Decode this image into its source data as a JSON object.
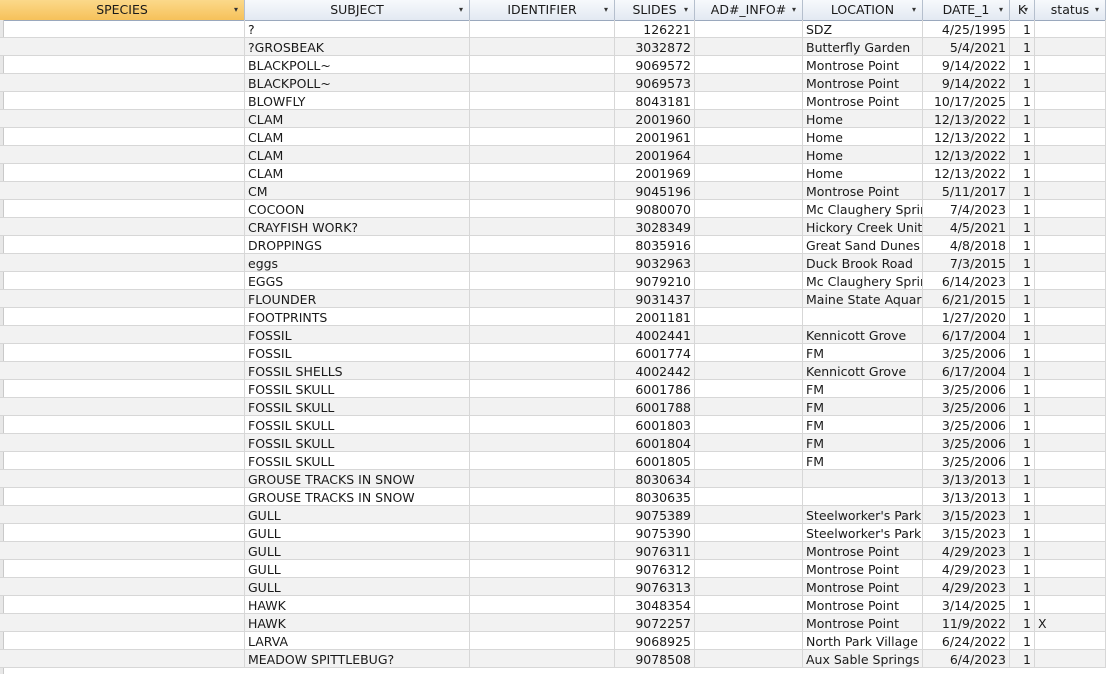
{
  "columns": [
    {
      "key": "species",
      "label": "SPECIES",
      "arrow": "sort-filter",
      "selected": true
    },
    {
      "key": "subject",
      "label": "SUBJECT",
      "arrow": "sort-filter"
    },
    {
      "key": "identifier",
      "label": "IDENTIFIER",
      "arrow": "filter"
    },
    {
      "key": "slides",
      "label": "SLIDES",
      "arrow": "sort-filter"
    },
    {
      "key": "ad_info",
      "label": "AD#_INFO#",
      "arrow": "filter"
    },
    {
      "key": "location",
      "label": "LOCATION",
      "arrow": "filter"
    },
    {
      "key": "date_1",
      "label": "DATE_1",
      "arrow": "filter"
    },
    {
      "key": "k",
      "label": "K",
      "arrow": "filter"
    },
    {
      "key": "status",
      "label": "status",
      "arrow": "filter"
    }
  ],
  "rows": [
    {
      "species": "",
      "subject": "?",
      "identifier": "",
      "slides": "126221",
      "ad_info": "",
      "location": "SDZ",
      "date_1": "4/25/1995",
      "k": "1",
      "status": ""
    },
    {
      "species": "",
      "subject": "?GROSBEAK",
      "identifier": "",
      "slides": "3032872",
      "ad_info": "",
      "location": "Butterfly Garden",
      "date_1": "5/4/2021",
      "k": "1",
      "status": ""
    },
    {
      "species": "",
      "subject": "BLACKPOLL~",
      "identifier": "",
      "slides": "9069572",
      "ad_info": "",
      "location": "Montrose Point",
      "date_1": "9/14/2022",
      "k": "1",
      "status": ""
    },
    {
      "species": "",
      "subject": "BLACKPOLL~",
      "identifier": "",
      "slides": "9069573",
      "ad_info": "",
      "location": "Montrose Point",
      "date_1": "9/14/2022",
      "k": "1",
      "status": ""
    },
    {
      "species": "",
      "subject": "BLOWFLY",
      "identifier": "",
      "slides": "8043181",
      "ad_info": "",
      "location": "Montrose Point",
      "date_1": "10/17/2025",
      "k": "1",
      "status": ""
    },
    {
      "species": "",
      "subject": "CLAM",
      "identifier": "",
      "slides": "2001960",
      "ad_info": "",
      "location": "Home",
      "date_1": "12/13/2022",
      "k": "1",
      "status": ""
    },
    {
      "species": "",
      "subject": "CLAM",
      "identifier": "",
      "slides": "2001961",
      "ad_info": "",
      "location": "Home",
      "date_1": "12/13/2022",
      "k": "1",
      "status": ""
    },
    {
      "species": "",
      "subject": "CLAM",
      "identifier": "",
      "slides": "2001964",
      "ad_info": "",
      "location": "Home",
      "date_1": "12/13/2022",
      "k": "1",
      "status": ""
    },
    {
      "species": "",
      "subject": "CLAM",
      "identifier": "",
      "slides": "2001969",
      "ad_info": "",
      "location": "Home",
      "date_1": "12/13/2022",
      "k": "1",
      "status": ""
    },
    {
      "species": "",
      "subject": "CM",
      "identifier": "",
      "slides": "9045196",
      "ad_info": "",
      "location": "Montrose Point",
      "date_1": "5/11/2017",
      "k": "1",
      "status": ""
    },
    {
      "species": "",
      "subject": "COCOON",
      "identifier": "",
      "slides": "9080070",
      "ad_info": "",
      "location": "Mc Claughery Sprir",
      "date_1": "7/4/2023",
      "k": "1",
      "status": ""
    },
    {
      "species": "",
      "subject": "CRAYFISH WORK?",
      "identifier": "",
      "slides": "3028349",
      "ad_info": "",
      "location": "Hickory Creek Unit",
      "date_1": "4/5/2021",
      "k": "1",
      "status": ""
    },
    {
      "species": "",
      "subject": "DROPPINGS",
      "identifier": "",
      "slides": "8035916",
      "ad_info": "",
      "location": "Great Sand Dunes I",
      "date_1": "4/8/2018",
      "k": "1",
      "status": ""
    },
    {
      "species": "",
      "subject": "eggs",
      "identifier": "",
      "slides": "9032963",
      "ad_info": "",
      "location": "Duck Brook Road",
      "date_1": "7/3/2015",
      "k": "1",
      "status": ""
    },
    {
      "species": "",
      "subject": "EGGS",
      "identifier": "",
      "slides": "9079210",
      "ad_info": "",
      "location": "Mc Claughery Sprir",
      "date_1": "6/14/2023",
      "k": "1",
      "status": ""
    },
    {
      "species": "",
      "subject": "FLOUNDER",
      "identifier": "",
      "slides": "9031437",
      "ad_info": "",
      "location": "Maine State Aquar",
      "date_1": "6/21/2015",
      "k": "1",
      "status": ""
    },
    {
      "species": "",
      "subject": "FOOTPRINTS",
      "identifier": "",
      "slides": "2001181",
      "ad_info": "",
      "location": "",
      "date_1": "1/27/2020",
      "k": "1",
      "status": ""
    },
    {
      "species": "",
      "subject": "FOSSIL",
      "identifier": "",
      "slides": "4002441",
      "ad_info": "",
      "location": "Kennicott Grove",
      "date_1": "6/17/2004",
      "k": "1",
      "status": ""
    },
    {
      "species": "",
      "subject": "FOSSIL",
      "identifier": "",
      "slides": "6001774",
      "ad_info": "",
      "location": "FM",
      "date_1": "3/25/2006",
      "k": "1",
      "status": ""
    },
    {
      "species": "",
      "subject": "FOSSIL SHELLS",
      "identifier": "",
      "slides": "4002442",
      "ad_info": "",
      "location": "Kennicott Grove",
      "date_1": "6/17/2004",
      "k": "1",
      "status": ""
    },
    {
      "species": "",
      "subject": "FOSSIL SKULL",
      "identifier": "",
      "slides": "6001786",
      "ad_info": "",
      "location": "FM",
      "date_1": "3/25/2006",
      "k": "1",
      "status": ""
    },
    {
      "species": "",
      "subject": "FOSSIL SKULL",
      "identifier": "",
      "slides": "6001788",
      "ad_info": "",
      "location": "FM",
      "date_1": "3/25/2006",
      "k": "1",
      "status": ""
    },
    {
      "species": "",
      "subject": "FOSSIL SKULL",
      "identifier": "",
      "slides": "6001803",
      "ad_info": "",
      "location": "FM",
      "date_1": "3/25/2006",
      "k": "1",
      "status": ""
    },
    {
      "species": "",
      "subject": "FOSSIL SKULL",
      "identifier": "",
      "slides": "6001804",
      "ad_info": "",
      "location": "FM",
      "date_1": "3/25/2006",
      "k": "1",
      "status": ""
    },
    {
      "species": "",
      "subject": "FOSSIL SKULL",
      "identifier": "",
      "slides": "6001805",
      "ad_info": "",
      "location": "FM",
      "date_1": "3/25/2006",
      "k": "1",
      "status": ""
    },
    {
      "species": "",
      "subject": "GROUSE TRACKS IN SNOW",
      "identifier": "",
      "slides": "8030634",
      "ad_info": "",
      "location": "",
      "date_1": "3/13/2013",
      "k": "1",
      "status": ""
    },
    {
      "species": "",
      "subject": "GROUSE TRACKS IN SNOW",
      "identifier": "",
      "slides": "8030635",
      "ad_info": "",
      "location": "",
      "date_1": "3/13/2013",
      "k": "1",
      "status": ""
    },
    {
      "species": "",
      "subject": "GULL",
      "identifier": "",
      "slides": "9075389",
      "ad_info": "",
      "location": "Steelworker's Park",
      "date_1": "3/15/2023",
      "k": "1",
      "status": ""
    },
    {
      "species": "",
      "subject": "GULL",
      "identifier": "",
      "slides": "9075390",
      "ad_info": "",
      "location": "Steelworker's Park",
      "date_1": "3/15/2023",
      "k": "1",
      "status": ""
    },
    {
      "species": "",
      "subject": "GULL",
      "identifier": "",
      "slides": "9076311",
      "ad_info": "",
      "location": "Montrose Point",
      "date_1": "4/29/2023",
      "k": "1",
      "status": ""
    },
    {
      "species": "",
      "subject": "GULL",
      "identifier": "",
      "slides": "9076312",
      "ad_info": "",
      "location": "Montrose Point",
      "date_1": "4/29/2023",
      "k": "1",
      "status": ""
    },
    {
      "species": "",
      "subject": "GULL",
      "identifier": "",
      "slides": "9076313",
      "ad_info": "",
      "location": "Montrose Point",
      "date_1": "4/29/2023",
      "k": "1",
      "status": ""
    },
    {
      "species": "",
      "subject": "HAWK",
      "identifier": "",
      "slides": "3048354",
      "ad_info": "",
      "location": "Montrose Point",
      "date_1": "3/14/2025",
      "k": "1",
      "status": ""
    },
    {
      "species": "",
      "subject": "HAWK",
      "identifier": "",
      "slides": "9072257",
      "ad_info": "",
      "location": "Montrose Point",
      "date_1": "11/9/2022",
      "k": "1",
      "status": "X"
    },
    {
      "species": "",
      "subject": "LARVA",
      "identifier": "",
      "slides": "9068925",
      "ad_info": "",
      "location": "North Park Village",
      "date_1": "6/24/2022",
      "k": "1",
      "status": ""
    },
    {
      "species": "",
      "subject": "MEADOW SPITTLEBUG?",
      "identifier": "",
      "slides": "9078508",
      "ad_info": "",
      "location": "Aux Sable Springs I",
      "date_1": "6/4/2023",
      "k": "1",
      "status": ""
    }
  ]
}
